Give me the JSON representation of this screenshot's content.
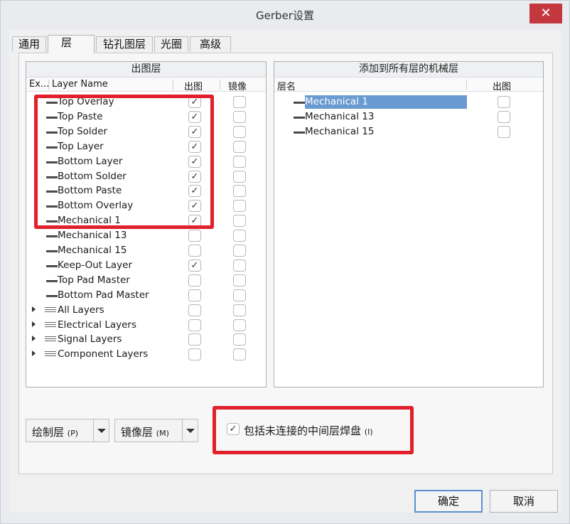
{
  "window": {
    "title": "Gerber设置",
    "close_label": "✕"
  },
  "tabs": [
    {
      "label": "通用",
      "active": false
    },
    {
      "label": "层",
      "active": true
    },
    {
      "label": "钻孔图层",
      "active": false
    },
    {
      "label": "光圈",
      "active": false
    },
    {
      "label": "高级",
      "active": false
    }
  ],
  "plot_layers": {
    "title": "出图层",
    "columns": {
      "expand": "Ex...",
      "name": "Layer Name",
      "plot": "出图",
      "mirror": "镜像"
    },
    "rows": [
      {
        "name": "Top Overlay",
        "plot": "✓",
        "mirror": ""
      },
      {
        "name": "Top Paste",
        "plot": "✓",
        "mirror": ""
      },
      {
        "name": "Top Solder",
        "plot": "✓",
        "mirror": ""
      },
      {
        "name": "Top Layer",
        "plot": "✓",
        "mirror": ""
      },
      {
        "name": "Bottom Layer",
        "plot": "✓",
        "mirror": ""
      },
      {
        "name": "Bottom Solder",
        "plot": "✓",
        "mirror": ""
      },
      {
        "name": "Bottom Paste",
        "plot": "✓",
        "mirror": ""
      },
      {
        "name": "Bottom Overlay",
        "plot": "✓",
        "mirror": ""
      },
      {
        "name": "Mechanical 1",
        "plot": "✓",
        "mirror": ""
      },
      {
        "name": "Mechanical 13",
        "plot": "",
        "mirror": ""
      },
      {
        "name": "Mechanical 15",
        "plot": "",
        "mirror": ""
      },
      {
        "name": "Keep-Out Layer",
        "plot": "✓",
        "mirror": ""
      },
      {
        "name": "Top Pad Master",
        "plot": "",
        "mirror": ""
      },
      {
        "name": "Bottom Pad Master",
        "plot": "",
        "mirror": ""
      },
      {
        "name": "All Layers",
        "plot": "",
        "mirror": ""
      },
      {
        "name": "Electrical Layers",
        "plot": "",
        "mirror": ""
      },
      {
        "name": "Signal Layers",
        "plot": "",
        "mirror": ""
      },
      {
        "name": "Component Layers",
        "plot": "",
        "mirror": ""
      }
    ]
  },
  "mechanical_layers": {
    "title": "添加到所有层的机械层",
    "columns": {
      "name": "层名",
      "plot": "出图"
    },
    "rows": [
      {
        "name": "Mechanical 1",
        "plot": "",
        "selected": true
      },
      {
        "name": "Mechanical 13",
        "plot": "",
        "selected": false
      },
      {
        "name": "Mechanical 15",
        "plot": "",
        "selected": false
      }
    ]
  },
  "controls": {
    "plot_layers_dropdown": {
      "label": "绘制层",
      "key": "(P)"
    },
    "mirror_layers_dropdown": {
      "label": "镜像层",
      "key": "(M)"
    },
    "include_unconnected": {
      "checked": "✓",
      "label": "包括未连接的中间层焊盘",
      "key": "(I)"
    }
  },
  "buttons": {
    "ok": "确定",
    "cancel": "取消"
  },
  "annotations": {
    "highlight_color": "#e0202a"
  }
}
